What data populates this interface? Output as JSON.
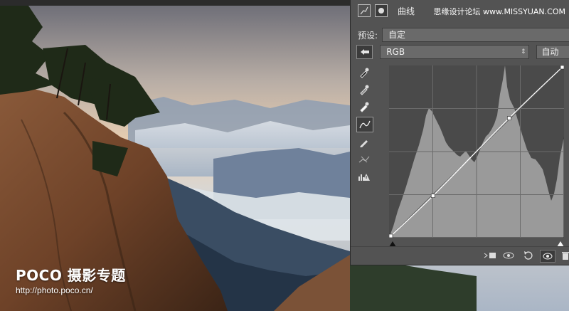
{
  "photo": {
    "watermark_brand": "POCO 摄影专题",
    "watermark_url": "http://photo.poco.cn/"
  },
  "panel": {
    "title": "曲线",
    "site_watermark": "思缘设计论坛 www.MISSYUAN.COM",
    "preset_label": "预设:",
    "preset_value": "自定",
    "channel_value": "RGB",
    "auto_label": "自动",
    "tools": [
      "eyedropper-black-icon",
      "eyedropper-gray-icon",
      "eyedropper-white-icon",
      "curve-edit-icon",
      "pencil-icon",
      "smooth-icon",
      "clipping-warning-icon"
    ],
    "curve_points": [
      {
        "input": 0,
        "output": 0
      },
      {
        "input": 64,
        "output": 62
      },
      {
        "input": 175,
        "output": 177
      },
      {
        "input": 255,
        "output": 255
      }
    ],
    "footer_buttons": [
      "clip-to-layer-icon",
      "view-previous-icon",
      "reset-icon",
      "visibility-icon",
      "delete-icon"
    ]
  }
}
